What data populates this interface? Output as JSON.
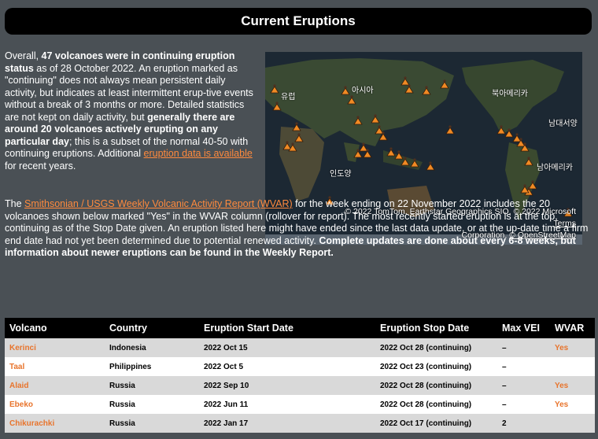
{
  "header": {
    "title": "Current Eruptions"
  },
  "intro": {
    "t1": "Overall, ",
    "bold1": "47 volcanoes were in continuing eruption status",
    "t2": " as of 28 October 2022. An eruption marked as \"continuing\" does not always mean persistent daily activity, but indicates at least intermittent erup-tive events without a break of 3 months or more. Detailed statistics are not kept on daily activity, but ",
    "bold2": "generally there are around 20 volcanoes actively erupting on any particular day",
    "t3": "; this is a subset of the normal 40-50 with continuing eruptions. Additional ",
    "link": "eruption data is available",
    "t4": " for recent years."
  },
  "report": {
    "t1": "The ",
    "link": "Smithsonian / USGS Weekly Volcanic Activity Report (WVAR)",
    "t2": " for the week ending on 22 November 2022 includes the 20 volcanoes shown below marked \"Yes\" in the WVAR column (rollover for report). The most recently started eruption is at the top, continuing as of the Stop Date given. An eruption listed here might have ended since the last data update, or at the up-date time a firm end date had not yet been determined due to potential renewed activity. ",
    "bold": "Complete updates are done about every 6-8 weeks, but information about newer eruptions can be found in the Weekly Report."
  },
  "map": {
    "labels": {
      "europe": "유럽",
      "asia": "아시아",
      "north_america": "북아메리카",
      "south_atlantic": "남대서양",
      "south_america": "남아메리카",
      "indian_ocean": "인도양"
    },
    "attribution": "© 2022 TomTom, Earthstar Geographics SIO, © 2022 Microsoft",
    "terms": "Terms",
    "attribution2": "Corporation, ",
    "osm": "© OpenStreetMap"
  },
  "table": {
    "headers": [
      "Volcano",
      "Country",
      "Eruption Start Date",
      "Eruption Stop Date",
      "Max VEI",
      "WVAR"
    ],
    "rows": [
      [
        "Kerinci",
        "Indonesia",
        "2022 Oct 15",
        "2022 Oct 28 (continuing)",
        "–",
        "Yes"
      ],
      [
        "Taal",
        "Philippines",
        "2022 Oct 5",
        "2022 Oct 23 (continuing)",
        "–",
        ""
      ],
      [
        "Alaid",
        "Russia",
        "2022 Sep 10",
        "2022 Oct 28 (continuing)",
        "–",
        "Yes"
      ],
      [
        "Ebeko",
        "Russia",
        "2022 Jun 11",
        "2022 Oct 28 (continuing)",
        "–",
        "Yes"
      ],
      [
        "Chikurachki",
        "Russia",
        "2022 Jan 17",
        "2022 Oct 17 (continuing)",
        "2",
        ""
      ]
    ]
  }
}
